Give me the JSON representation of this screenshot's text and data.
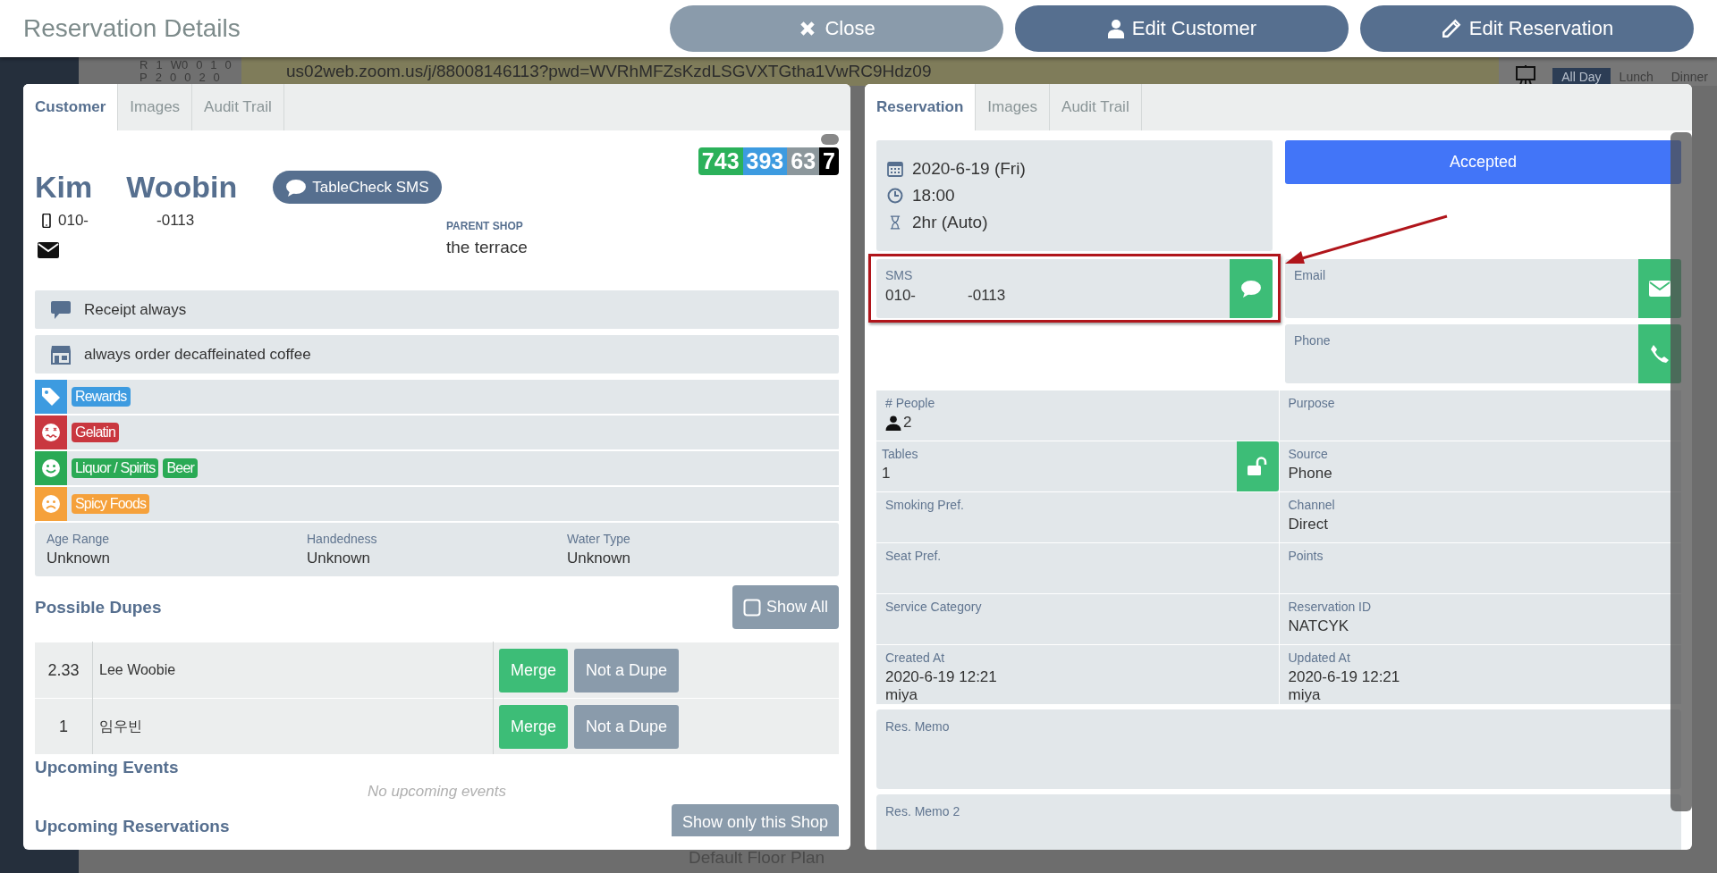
{
  "header": {
    "title": "Reservation Details",
    "buttons": [
      {
        "kind": "close",
        "label": "Close"
      },
      {
        "kind": "customer",
        "label": "Edit Customer"
      },
      {
        "kind": "reservation",
        "label": "Edit Reservation"
      }
    ]
  },
  "background": {
    "stats": [
      [
        "R",
        "1",
        "W0",
        "0",
        "1",
        "0"
      ],
      [
        "P",
        "2",
        "0",
        "0",
        "2",
        "0"
      ]
    ],
    "url": "us02web.zoom.us/j/88008146113?pwd=WVRhMFZsKzdLSGVXTGtha1VwRC9Hdz09",
    "meal_tabs": [
      {
        "label": "All Day",
        "selected": true
      },
      {
        "label": "Lunch",
        "selected": false
      },
      {
        "label": "Dinner",
        "selected": false
      }
    ],
    "floor_plan": "Default Floor Plan"
  },
  "customer": {
    "tabs": [
      {
        "label": "Customer",
        "selected": true
      },
      {
        "label": "Images",
        "selected": false
      },
      {
        "label": "Audit Trail",
        "selected": false
      }
    ],
    "first_name": "Kim",
    "last_name": "Woobin",
    "sms_button": "TableCheck SMS",
    "phone_prefix": "010-",
    "phone_suffix": "-0113",
    "parent_shop_label": "PARENT SHOP",
    "parent_shop": "the terrace",
    "scores": [
      {
        "value": "743",
        "color": "#2bb15a"
      },
      {
        "value": "393",
        "color": "#3d9be0"
      },
      {
        "value": "63",
        "color": "#8c979c"
      },
      {
        "value": "7",
        "color": "#000000"
      }
    ],
    "notes": [
      {
        "kind": "comment",
        "text": "Receipt always"
      },
      {
        "kind": "shop",
        "text": "always order decaffeinated coffee"
      }
    ],
    "tag_rows": [
      {
        "kind": "tag",
        "color": "#3d9be0",
        "tags": [
          "Rewards"
        ]
      },
      {
        "kind": "dislike",
        "color": "#c9373f",
        "tags": [
          "Gelatin"
        ]
      },
      {
        "kind": "like",
        "color": "#2aaa55",
        "tags": [
          "Liquor / Spirits",
          "Beer"
        ]
      },
      {
        "kind": "neutral",
        "color": "#f5a13b",
        "tags": [
          "Spicy Foods"
        ]
      }
    ],
    "attributes": [
      {
        "label": "Age Range",
        "value": "Unknown"
      },
      {
        "label": "Handedness",
        "value": "Unknown"
      },
      {
        "label": "Water Type",
        "value": "Unknown"
      }
    ],
    "dupes_title": "Possible Dupes",
    "show_all": {
      "label": "Show All",
      "checked": false
    },
    "dupes": [
      {
        "score": "2.33",
        "name": "Lee Woobie",
        "merge": "Merge",
        "not_dupe": "Not a Dupe"
      },
      {
        "score": "1",
        "name": "임우빈",
        "merge": "Merge",
        "not_dupe": "Not a Dupe"
      }
    ],
    "events_title": "Upcoming Events",
    "events_empty": "No upcoming events",
    "reservations_title": "Upcoming Reservations",
    "shop_button": "Show only this Shop"
  },
  "reservation": {
    "tabs": [
      {
        "label": "Reservation",
        "selected": true
      },
      {
        "label": "Images",
        "selected": false
      },
      {
        "label": "Audit Trail",
        "selected": false
      }
    ],
    "date": "2020-6-19 (Fri)",
    "time": "18:00",
    "duration": "2hr (Auto)",
    "status": "Accepted",
    "sms": {
      "label": "SMS",
      "prefix": "010-",
      "suffix": "-0113"
    },
    "email": {
      "label": "Email"
    },
    "phone": {
      "label": "Phone"
    },
    "fields": [
      {
        "kind": "people",
        "label": "# People",
        "value": "2"
      },
      {
        "kind": "text",
        "label": "Purpose"
      },
      {
        "kind": "tables",
        "label": "Tables",
        "value": "1"
      },
      {
        "kind": "text",
        "label": "Source",
        "value": "Phone"
      },
      {
        "kind": "text",
        "label": "Smoking Pref."
      },
      {
        "kind": "text",
        "label": "Channel",
        "value": "Direct"
      },
      {
        "kind": "text",
        "label": "Seat Pref."
      },
      {
        "kind": "text",
        "label": "Points"
      },
      {
        "kind": "text",
        "label": "Service Category"
      },
      {
        "kind": "text",
        "label": "Reservation ID",
        "value": "NATCYK"
      },
      {
        "kind": "text",
        "label": "Created At",
        "value": "2020-6-19 12:21",
        "by": "miya"
      },
      {
        "kind": "text",
        "label": "Updated At",
        "value": "2020-6-19 12:21",
        "by": "miya"
      }
    ],
    "memos": [
      "Res. Memo",
      "Res. Memo 2"
    ]
  }
}
